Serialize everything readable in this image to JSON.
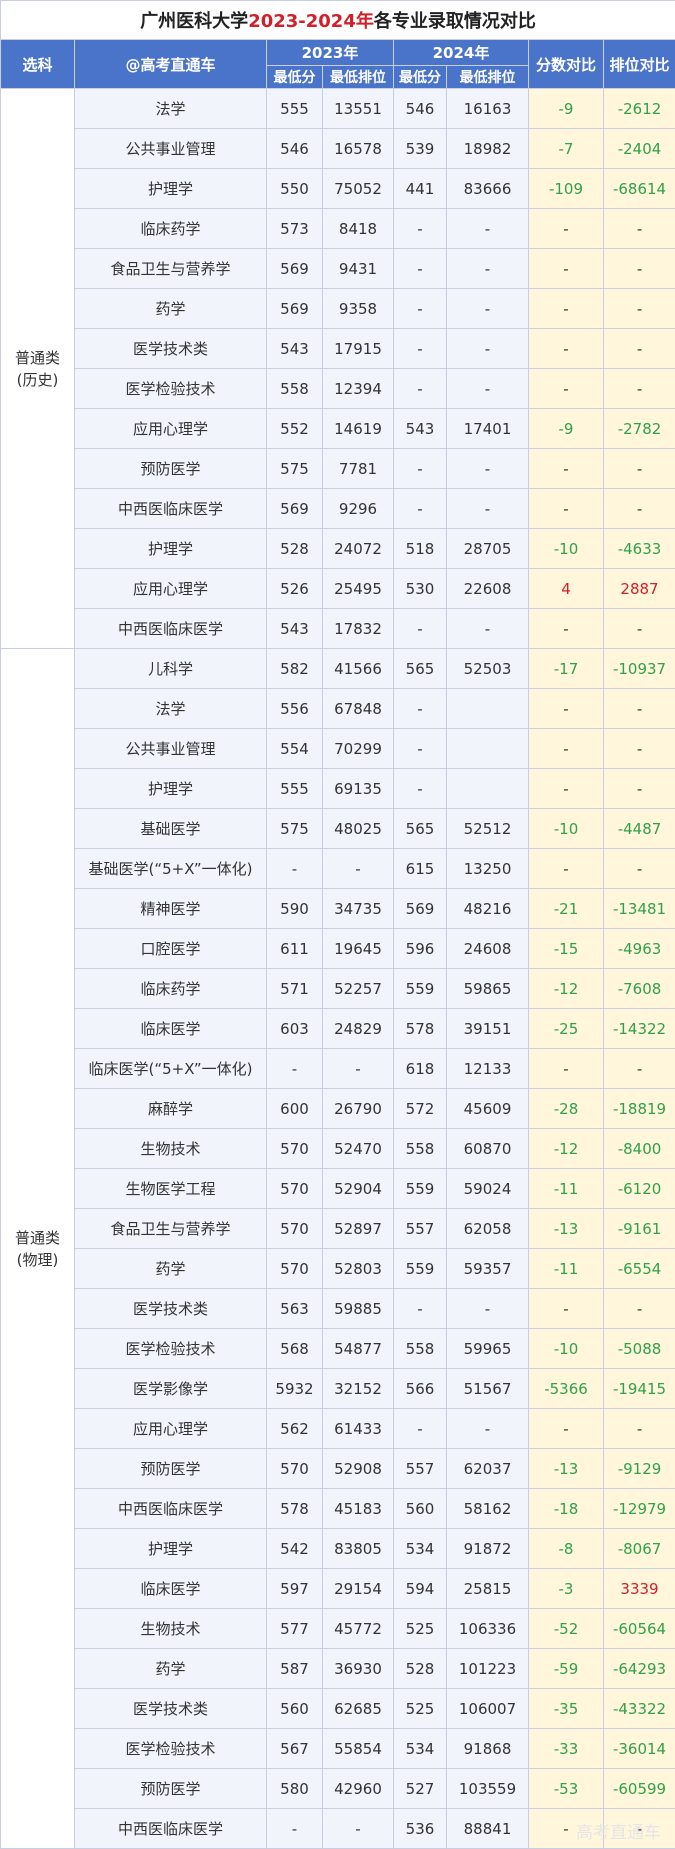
{
  "title": {
    "prefix": "广州医科大学",
    "highlight": "2023-2024年",
    "suffix": "各专业录取情况对比"
  },
  "header": {
    "subject": "选科",
    "brand": "@高考直通车",
    "y2023": "2023年",
    "y2024": "2024年",
    "score_diff": "分数对比",
    "rank_diff": "排位对比",
    "min_score": "最低分",
    "min_rank": "最低排位"
  },
  "groups": [
    {
      "name": "普通类\n(历史)",
      "rows": [
        [
          "法学",
          "555",
          "13551",
          "546",
          "16163",
          "-9",
          "-2612"
        ],
        [
          "公共事业管理",
          "546",
          "16578",
          "539",
          "18982",
          "-7",
          "-2404"
        ],
        [
          "护理学",
          "550",
          "75052",
          "441",
          "83666",
          "-109",
          "-68614"
        ],
        [
          "临床药学",
          "573",
          "8418",
          "-",
          "-",
          "-",
          "-"
        ],
        [
          "食品卫生与营养学",
          "569",
          "9431",
          "-",
          "-",
          "-",
          "-"
        ],
        [
          "药学",
          "569",
          "9358",
          "-",
          "-",
          "-",
          "-"
        ],
        [
          "医学技术类",
          "543",
          "17915",
          "-",
          "-",
          "-",
          "-"
        ],
        [
          "医学检验技术",
          "558",
          "12394",
          "-",
          "-",
          "-",
          "-"
        ],
        [
          "应用心理学",
          "552",
          "14619",
          "543",
          "17401",
          "-9",
          "-2782"
        ],
        [
          "预防医学",
          "575",
          "7781",
          "-",
          "-",
          "-",
          "-"
        ],
        [
          "中西医临床医学",
          "569",
          "9296",
          "-",
          "-",
          "-",
          "-"
        ],
        [
          "护理学",
          "528",
          "24072",
          "518",
          "28705",
          "-10",
          "-4633"
        ],
        [
          "应用心理学",
          "526",
          "25495",
          "530",
          "22608",
          "4",
          "2887"
        ],
        [
          "中西医临床医学",
          "543",
          "17832",
          "-",
          "-",
          "-",
          "-"
        ]
      ]
    },
    {
      "name": "普通类\n(物理)",
      "rows": [
        [
          "儿科学",
          "582",
          "41566",
          "565",
          "52503",
          "-17",
          "-10937"
        ],
        [
          "法学",
          "556",
          "67848",
          "-",
          "",
          "-",
          "-"
        ],
        [
          "公共事业管理",
          "554",
          "70299",
          "-",
          "",
          "-",
          "-"
        ],
        [
          "护理学",
          "555",
          "69135",
          "-",
          "",
          "-",
          "-"
        ],
        [
          "基础医学",
          "575",
          "48025",
          "565",
          "52512",
          "-10",
          "-4487"
        ],
        [
          "基础医学(“5+X”一体化)",
          "-",
          "-",
          "615",
          "13250",
          "-",
          "-"
        ],
        [
          "精神医学",
          "590",
          "34735",
          "569",
          "48216",
          "-21",
          "-13481"
        ],
        [
          "口腔医学",
          "611",
          "19645",
          "596",
          "24608",
          "-15",
          "-4963"
        ],
        [
          "临床药学",
          "571",
          "52257",
          "559",
          "59865",
          "-12",
          "-7608"
        ],
        [
          "临床医学",
          "603",
          "24829",
          "578",
          "39151",
          "-25",
          "-14322"
        ],
        [
          "临床医学(“5+X”一体化)",
          "-",
          "-",
          "618",
          "12133",
          "-",
          "-"
        ],
        [
          "麻醉学",
          "600",
          "26790",
          "572",
          "45609",
          "-28",
          "-18819"
        ],
        [
          "生物技术",
          "570",
          "52470",
          "558",
          "60870",
          "-12",
          "-8400"
        ],
        [
          "生物医学工程",
          "570",
          "52904",
          "559",
          "59024",
          "-11",
          "-6120"
        ],
        [
          "食品卫生与营养学",
          "570",
          "52897",
          "557",
          "62058",
          "-13",
          "-9161"
        ],
        [
          "药学",
          "570",
          "52803",
          "559",
          "59357",
          "-11",
          "-6554"
        ],
        [
          "医学技术类",
          "563",
          "59885",
          "-",
          "-",
          "-",
          "-"
        ],
        [
          "医学检验技术",
          "568",
          "54877",
          "558",
          "59965",
          "-10",
          "-5088"
        ],
        [
          "医学影像学",
          "5932",
          "32152",
          "566",
          "51567",
          "-5366",
          "-19415"
        ],
        [
          "应用心理学",
          "562",
          "61433",
          "-",
          "-",
          "-",
          "-"
        ],
        [
          "预防医学",
          "570",
          "52908",
          "557",
          "62037",
          "-13",
          "-9129"
        ],
        [
          "中西医临床医学",
          "578",
          "45183",
          "560",
          "58162",
          "-18",
          "-12979"
        ],
        [
          "护理学",
          "542",
          "83805",
          "534",
          "91872",
          "-8",
          "-8067"
        ],
        [
          "临床医学",
          "597",
          "29154",
          "594",
          "25815",
          "-3",
          "3339"
        ],
        [
          "生物技术",
          "577",
          "45772",
          "525",
          "106336",
          "-52",
          "-60564"
        ],
        [
          "药学",
          "587",
          "36930",
          "528",
          "101223",
          "-59",
          "-64293"
        ],
        [
          "医学技术类",
          "560",
          "62685",
          "525",
          "106007",
          "-35",
          "-43322"
        ],
        [
          "医学检验技术",
          "567",
          "55854",
          "534",
          "91868",
          "-33",
          "-36014"
        ],
        [
          "预防医学",
          "580",
          "42960",
          "527",
          "103559",
          "-53",
          "-60599"
        ],
        [
          "中西医临床医学",
          "-",
          "-",
          "536",
          "88841",
          "-",
          "-"
        ]
      ]
    }
  ],
  "colors": {
    "header_bg": "#4a74c9",
    "title_highlight": "#d0202a",
    "negative": "#2fa24a",
    "positive": "#d0202a",
    "compare_bg": "#fff6dc"
  },
  "footer_brand": "高考直通车"
}
